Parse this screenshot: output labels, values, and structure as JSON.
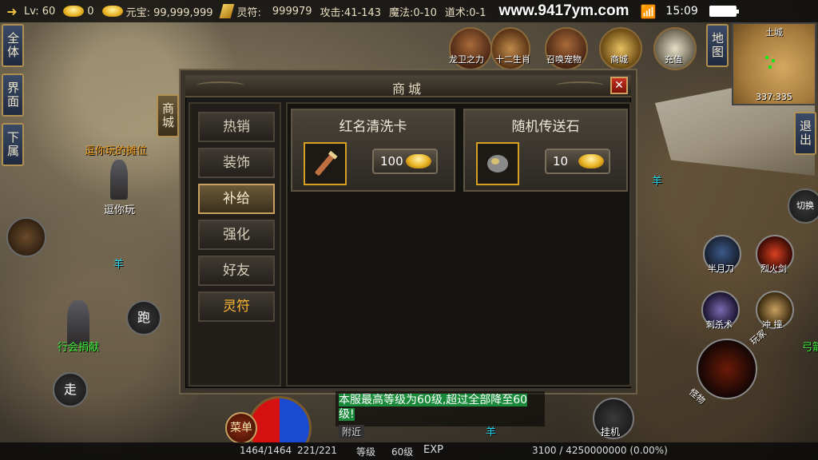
{
  "topbar": {
    "level_label": "Lv: 60",
    "gold_count": "0",
    "yuanbao_label": "元宝: 99,999,999",
    "lingfu_label": "灵符:",
    "lingfu_value": "999979",
    "attack_label": "攻击:41-143",
    "magic_label": "魔法:0-10",
    "tao_label": "道术:0-1",
    "site": "www.9417ym.com",
    "time": "15:09"
  },
  "left_buttons": [
    "全体",
    "界面",
    "下属"
  ],
  "side_tab_shop": "商城",
  "features": [
    {
      "label": "龙卫之力",
      "icon": "dragon-guard-icon"
    },
    {
      "label": "十二生肖",
      "icon": "zodiac-icon"
    },
    {
      "label": "召唤宠物",
      "icon": "pet-summon-icon"
    },
    {
      "label": "商城",
      "icon": "shop-icon"
    },
    {
      "label": "充值",
      "icon": "recharge-icon"
    }
  ],
  "map_button": "地图",
  "exit_button": "退出",
  "switch_button": "切换",
  "minimap": {
    "title": "土城",
    "coords": "337:335"
  },
  "world": {
    "npc_title": "逗你玩的摊位",
    "npc_name": "逗你玩",
    "sheep1": "羊",
    "sheep2": "羊",
    "sheep3": "羊",
    "guild_donate": "行会捐献",
    "archer_partial": "弓箭"
  },
  "controls": {
    "run": "跑",
    "walk": "走",
    "menu": "菜单",
    "hook": "挂机",
    "play_label": "玩家",
    "monster_label": "怪物"
  },
  "skills": [
    {
      "label": "半月刀",
      "icon": "half-moon-blade-icon"
    },
    {
      "label": "烈火剑",
      "icon": "flaming-sword-icon"
    },
    {
      "label": "刺杀术",
      "icon": "assassinate-icon"
    },
    {
      "label": "冲 撞",
      "icon": "charge-icon"
    }
  ],
  "shop": {
    "title": "商城",
    "close": "✕",
    "tabs": [
      {
        "label": "热销",
        "active": false
      },
      {
        "label": "装饰",
        "active": false
      },
      {
        "label": "补给",
        "active": true
      },
      {
        "label": "强化",
        "active": false
      },
      {
        "label": "好友",
        "active": false
      },
      {
        "label": "灵符",
        "active": false
      }
    ],
    "items": [
      {
        "name": "红名清洗卡",
        "price": "100",
        "icon": "scroll-icon"
      },
      {
        "name": "随机传送石",
        "price": "10",
        "icon": "stone-icon"
      }
    ]
  },
  "chat": {
    "message": "本服最高等级为60级,超过全部降至60级!",
    "channel": "附近"
  },
  "bottom": {
    "hp": "1464/1464",
    "mp": "221/221",
    "level_label": "等级",
    "level_value": "60级",
    "exp_label": "EXP",
    "exp_value": "3100 / 4250000000 (0.00%)"
  }
}
